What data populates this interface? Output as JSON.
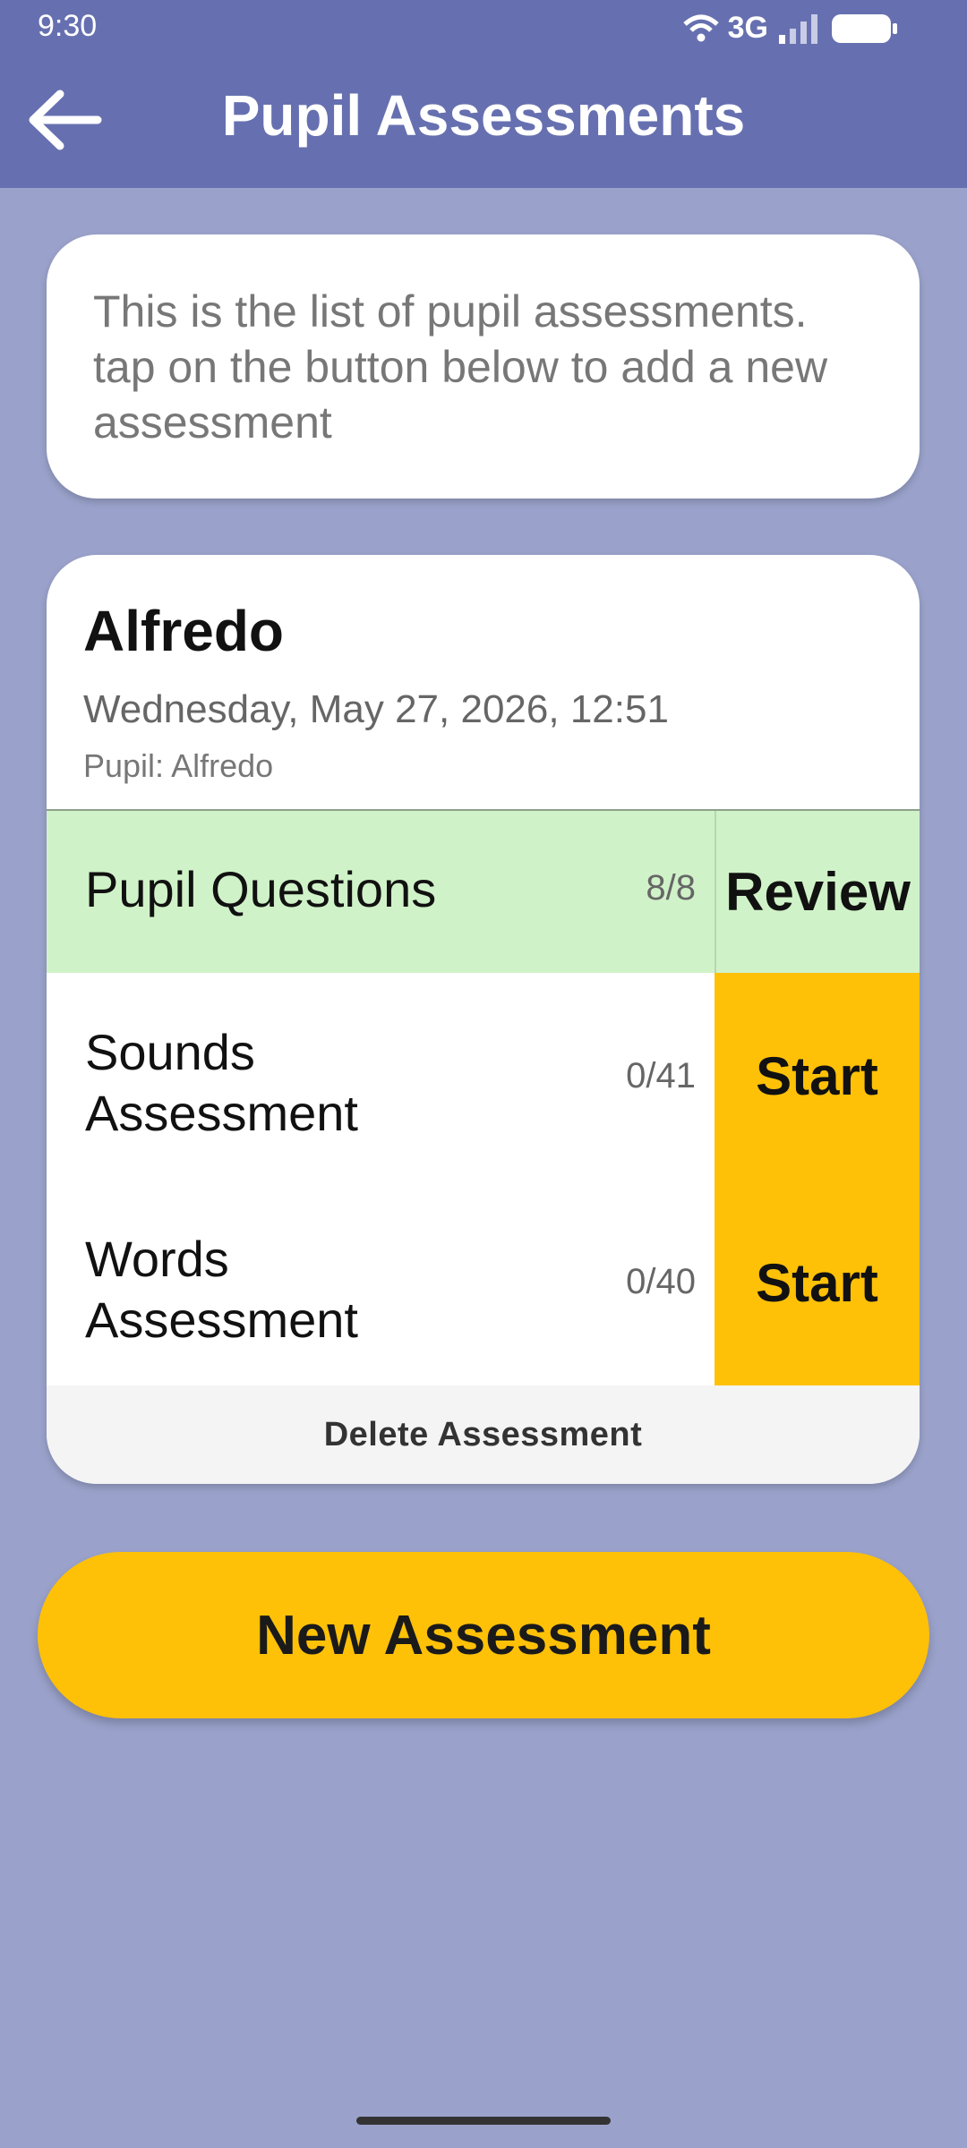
{
  "status_bar": {
    "time": "9:30",
    "network": "3G",
    "icons": [
      "wifi-icon",
      "signal-icon",
      "battery-icon"
    ]
  },
  "header": {
    "title": "Pupil Assessments",
    "back_icon": "back-arrow-icon"
  },
  "info": {
    "text": "This is the list of pupil assessments. tap on the button below to add a new assessment"
  },
  "assessment": {
    "name": "Alfredo",
    "date": "Wednesday, May 27, 2026, 12:51",
    "pupil": "Pupil: Alfredo",
    "rows": [
      {
        "label": "Pupil Questions",
        "count": "8/8",
        "action": "Review"
      },
      {
        "label": "Sounds Assessment",
        "count": "0/41",
        "action": "Start"
      },
      {
        "label": "Words Assessment",
        "count": "0/40",
        "action": "Start"
      }
    ],
    "delete_label": "Delete Assessment"
  },
  "new_button": "New Assessment",
  "colors": {
    "app_bar": "#6670b0",
    "background": "#9aa2cb",
    "accent": "#ffc107",
    "completed_row": "#d0f2c8"
  }
}
